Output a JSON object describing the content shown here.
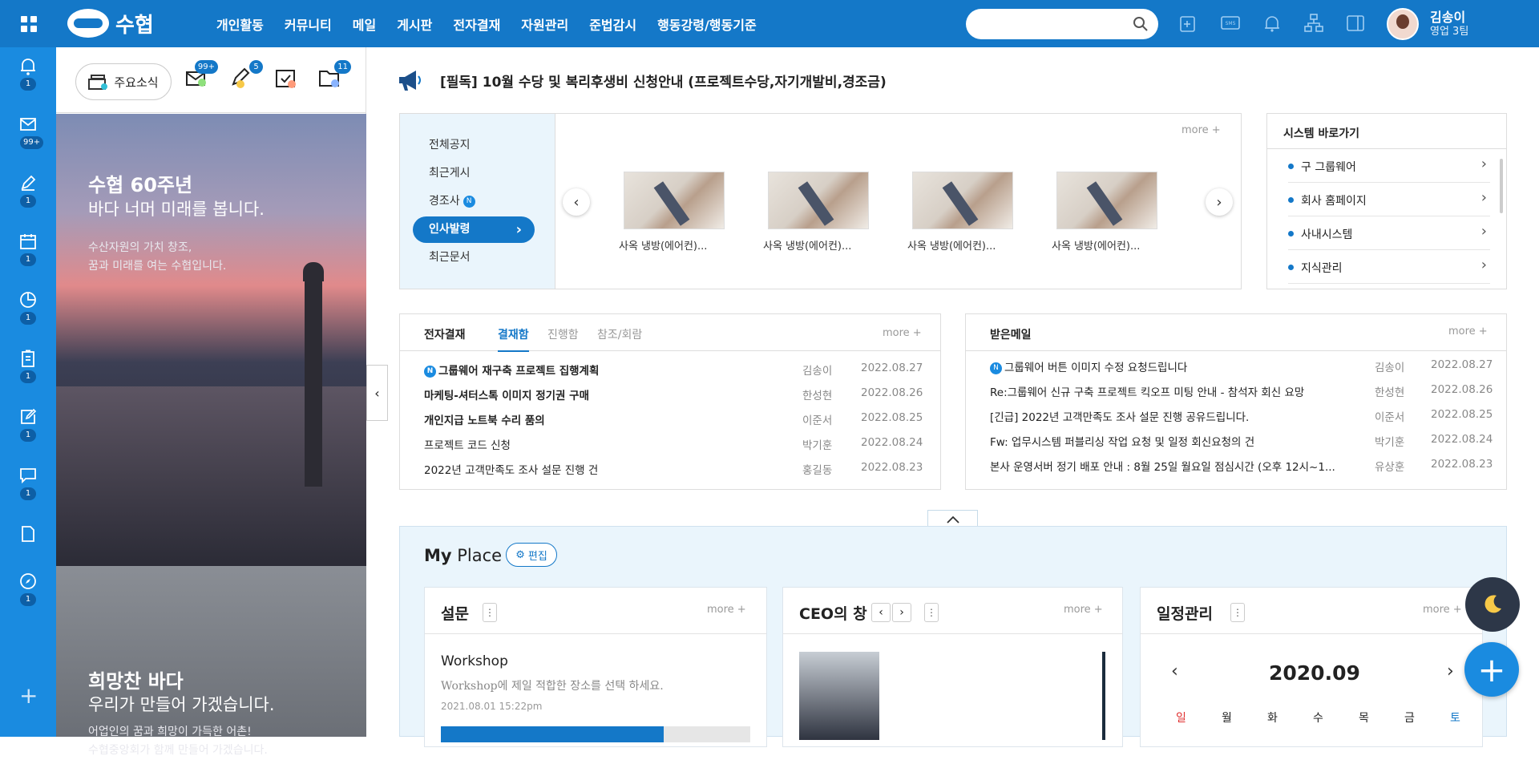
{
  "app": {
    "logo_text": "수협",
    "brand_color": "#1478c8"
  },
  "gnb": [
    "개인활동",
    "커뮤니티",
    "메일",
    "게시판",
    "전자결재",
    "자원관리",
    "준법감시",
    "행동강령/행동기준"
  ],
  "search": {
    "placeholder": ""
  },
  "top_icons": [
    "new-window-icon",
    "sms-icon",
    "bell-icon",
    "org-chart-icon",
    "panel-toggle-icon"
  ],
  "user": {
    "name": "김송이",
    "dept": "영업 3팀"
  },
  "lnb": {
    "items": [
      {
        "icon": "bell-icon",
        "count": "1"
      },
      {
        "icon": "mail-icon",
        "count": "99+"
      },
      {
        "icon": "pen-icon",
        "count": "1"
      },
      {
        "icon": "calendar-icon",
        "count": "1"
      },
      {
        "icon": "pie-chart-icon",
        "count": "1"
      },
      {
        "icon": "clipboard-icon",
        "count": "1"
      },
      {
        "icon": "edit-icon",
        "count": "1"
      },
      {
        "icon": "chat-icon",
        "count": "1"
      },
      {
        "icon": "document-icon",
        "count": ""
      },
      {
        "icon": "compass-icon",
        "count": "1"
      }
    ]
  },
  "side": {
    "news_label": "주요소식",
    "badges": {
      "mail": "99+",
      "approval": "5",
      "calendar": "",
      "folder": "11"
    },
    "banner1": {
      "title": "수협 60주년",
      "sub": "바다 너머 미래를 봅니다.",
      "desc": "수산자원의 가치 창조,\n꿈과 미래를 여는 수협입니다."
    },
    "banner2": {
      "title": "희망찬 바다",
      "sub": "우리가 만들어 가겠습니다.",
      "desc": "어업인의 꿈과 희망이 가득한 어촌!\n수협중앙회가 함께 만들어 가겠습니다."
    }
  },
  "notice": {
    "text": "[필독] 10월 수당 및 복리후생비 신청안내 (프로젝트수당,자기개발비,경조금)"
  },
  "board": {
    "menu": [
      "전체공지",
      "최근게시",
      "경조사",
      "인사발령",
      "최근문서"
    ],
    "new_badge": "N",
    "more": "more +",
    "thumbs": [
      "사옥 냉방(에어컨)...",
      "사옥 냉방(에어컨)...",
      "사옥 냉방(에어컨)...",
      "사옥 냉방(에어컨)..."
    ]
  },
  "system": {
    "title": "시스템 바로가기",
    "items": [
      "구 그룹웨어",
      "회사 홈페이지",
      "사내시스템",
      "지식관리"
    ]
  },
  "approval": {
    "title": "전자결재",
    "tabs": [
      "결재함",
      "진행함",
      "참조/회람"
    ],
    "more": "more +",
    "rows": [
      {
        "new": "N",
        "title": "그룹웨어 재구축 프로젝트 집행계획",
        "author": "김송이",
        "date": "2022.08.27"
      },
      {
        "new": "",
        "title": "마케팅-셔터스톡 이미지 정기권 구매",
        "author": "한성현",
        "date": "2022.08.26"
      },
      {
        "new": "",
        "title": "개인지급 노트북 수리 품의",
        "author": "이준서",
        "date": "2022.08.25"
      },
      {
        "new": "",
        "title": "프로젝트 코드 신청",
        "author": "박기훈",
        "date": "2022.08.24"
      },
      {
        "new": "",
        "title": "2022년 고객만족도 조사 설문 진행 건",
        "author": "홍길동",
        "date": "2022.08.23"
      }
    ]
  },
  "mail": {
    "title": "받은메일",
    "more": "more +",
    "rows": [
      {
        "new": "N",
        "title": "그룹웨어 버튼 이미지 수정 요청드립니다",
        "author": "김송이",
        "date": "2022.08.27"
      },
      {
        "new": "",
        "title": "Re:그룹웨어 신규 구축 프로젝트 킥오프 미팅 안내 - 참석자 회신 요망",
        "author": "한성현",
        "date": "2022.08.26"
      },
      {
        "new": "",
        "title": "[긴급] 2022년 고객만족도 조사 설문 진행 공유드립니다.",
        "author": "이준서",
        "date": "2022.08.25"
      },
      {
        "new": "",
        "title": "Fw: 업무시스템 퍼블리싱 작업 요청 및 일정 회신요청의 건",
        "author": "박기훈",
        "date": "2022.08.24"
      },
      {
        "new": "",
        "title": "본사 운영서버 정기 배포 안내 : 8월 25일 월요일 점심시간 (오후 12시~1...",
        "author": "유상훈",
        "date": "2022.08.23"
      }
    ]
  },
  "myplace": {
    "title_a": "My",
    "title_b": " Place",
    "edit_label": "편집",
    "cards": {
      "survey": {
        "title": "설문",
        "more": "more +",
        "item_title": "Workshop",
        "item_desc": "Workshop에 제일 적합한 장소를 선택 하세요.",
        "item_date": "2021.08.01 15:22pm"
      },
      "ceo": {
        "title": "CEO의 창",
        "more": "more +"
      },
      "schedule": {
        "title": "일정관리",
        "more": "more +",
        "month": "2020.09",
        "weekdays": [
          "일",
          "월",
          "화",
          "수",
          "목",
          "금",
          "토"
        ]
      }
    }
  },
  "colors": {
    "sunday": "#e03030",
    "saturday": "#1478c8",
    "accent": "#1478c8"
  }
}
